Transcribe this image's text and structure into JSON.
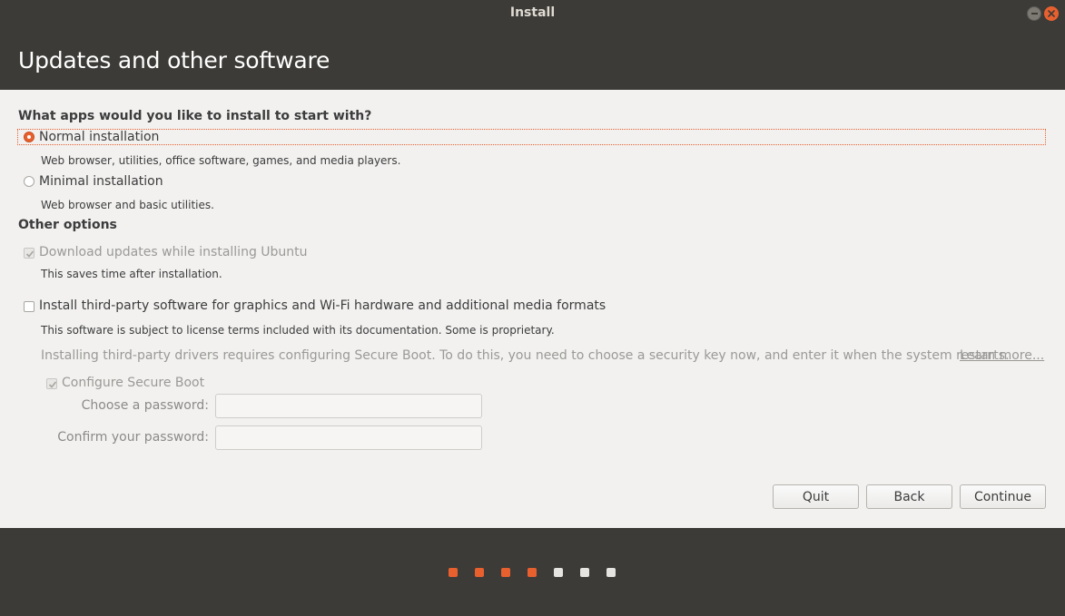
{
  "window": {
    "title": "Install"
  },
  "header": {
    "title": "Updates and other software"
  },
  "apps": {
    "heading": "What apps would you like to install to start with?",
    "normal": {
      "label": "Normal installation",
      "description": "Web browser, utilities, office software, games, and media players.",
      "selected": true
    },
    "minimal": {
      "label": "Minimal installation",
      "description": "Web browser and basic utilities.",
      "selected": false
    }
  },
  "other": {
    "heading": "Other options",
    "download_updates": {
      "label": "Download updates while installing Ubuntu",
      "description": "This saves time after installation.",
      "checked": true,
      "enabled": false
    },
    "third_party": {
      "label": "Install third-party software for graphics and Wi-Fi hardware and additional media formats",
      "description": "This software is subject to license terms included with its documentation. Some is proprietary.",
      "checked": false,
      "enabled": true
    },
    "secure_boot_info": "Installing third-party drivers requires configuring Secure Boot. To do this, you need to choose a security key now, and enter it when the system restarts.",
    "learn_more": "Learn more...",
    "configure_secure_boot": {
      "label": "Configure Secure Boot",
      "checked": true,
      "enabled": false
    },
    "password_label": "Choose a password:",
    "confirm_label": "Confirm your password:",
    "password_value": "",
    "confirm_value": ""
  },
  "buttons": {
    "quit": "Quit",
    "back": "Back",
    "continue": "Continue"
  },
  "progress": {
    "completed_steps": 4,
    "total_steps": 7
  },
  "colors": {
    "accent": "#e9602f",
    "chrome": "#3c3b37",
    "content_bg": "#f2f1f0"
  }
}
